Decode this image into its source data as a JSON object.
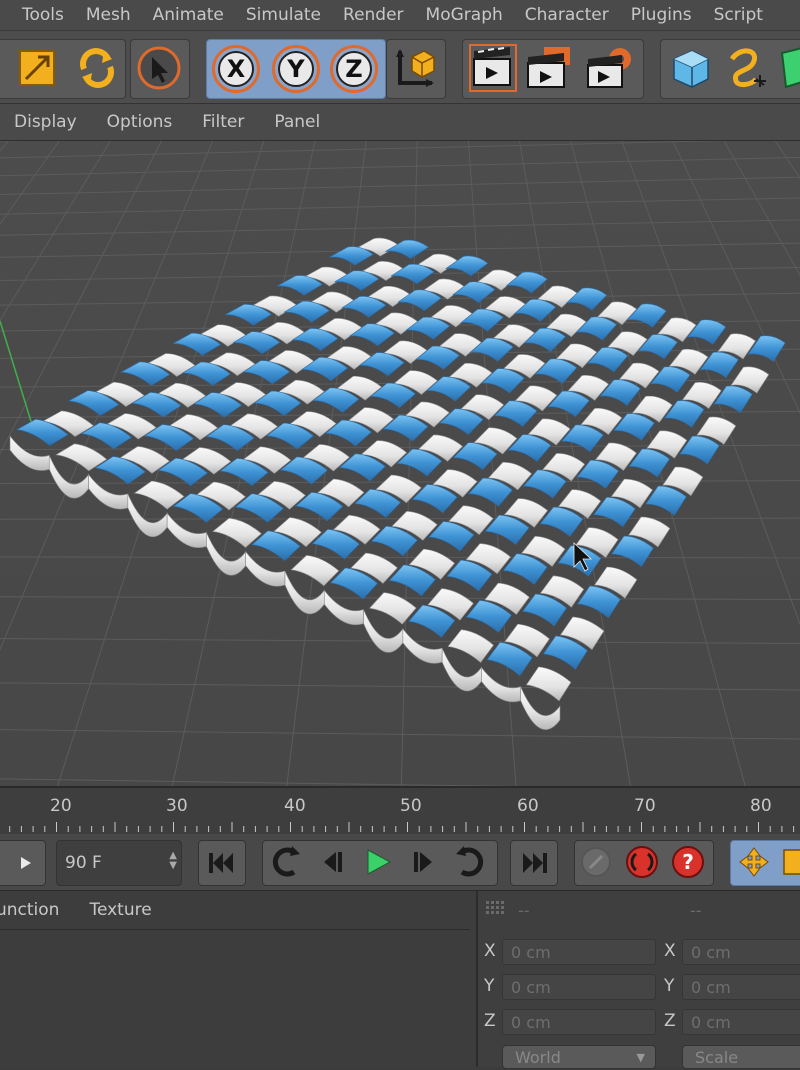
{
  "menu": [
    "Tools",
    "Mesh",
    "Animate",
    "Simulate",
    "Render",
    "MoGraph",
    "Character",
    "Plugins",
    "Script"
  ],
  "view_menu": [
    "Display",
    "Options",
    "Filter",
    "Panel"
  ],
  "toolbar": {
    "axis_x": "X",
    "axis_y": "Y",
    "axis_z": "Z"
  },
  "timeline": {
    "ticks": [
      "20",
      "30",
      "40",
      "50",
      "60",
      "70",
      "80"
    ]
  },
  "transport": {
    "frame_value": "90 F"
  },
  "tabs": [
    "unction",
    "Texture"
  ],
  "coords": {
    "header_left": "--",
    "header_right": "--",
    "labels": [
      "X",
      "Y",
      "Z"
    ],
    "values_left": [
      "0 cm",
      "0 cm",
      "0 cm"
    ],
    "values_right": [
      "0 cm",
      "0 cm",
      "0 cm"
    ],
    "mode_left": "World",
    "mode_right": "Scale"
  },
  "colors": {
    "accent_blue": "#3f93d4",
    "cloth_white": "#e9e9e9",
    "play_green": "#3bd16a"
  }
}
